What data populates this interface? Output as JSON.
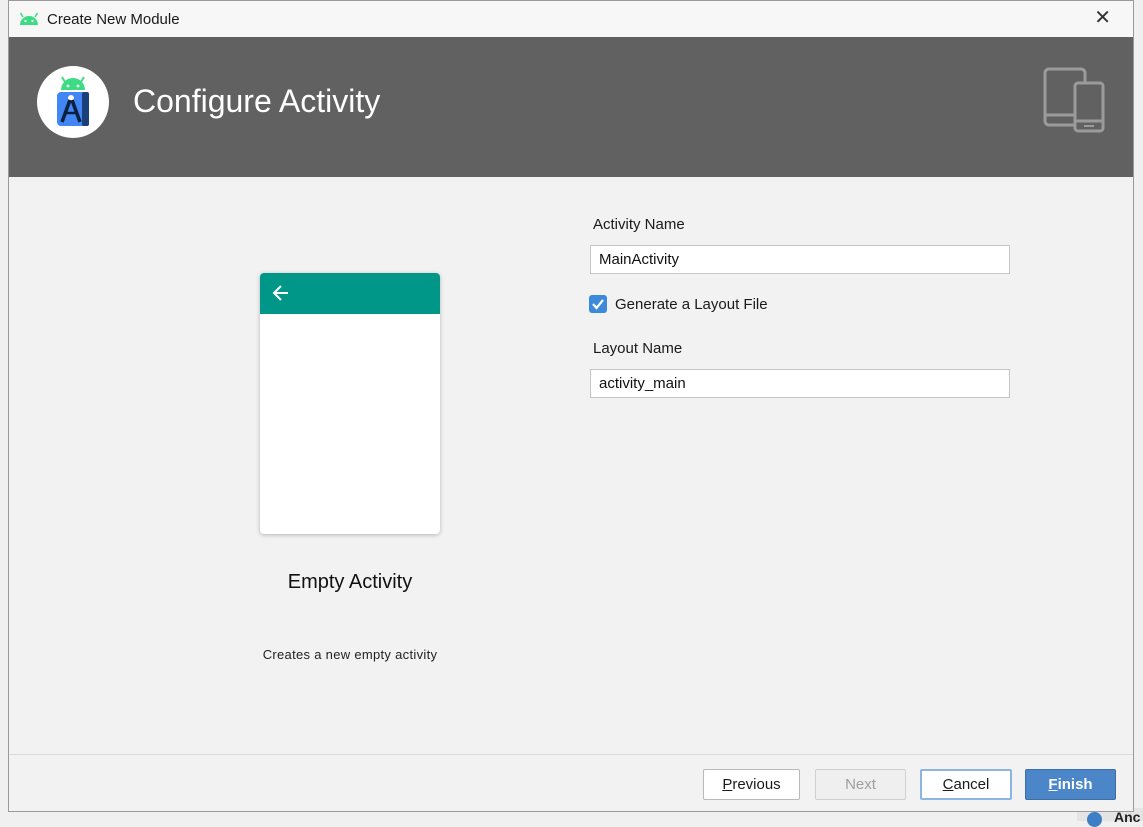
{
  "window": {
    "title": "Create New Module",
    "close_glyph": "✕",
    "app_icon": "android-icon"
  },
  "banner": {
    "heading": "Configure Activity",
    "logo": "android-studio-logo",
    "device_icon": "phone-tablet-icon",
    "background": "#616161"
  },
  "template": {
    "name": "Empty Activity",
    "description": "Creates a new empty activity",
    "appbar_color": "#009688"
  },
  "form": {
    "activity_name_label": "Activity Name",
    "activity_name_value": "MainActivity",
    "generate_layout_label": "Generate a Layout File",
    "generate_layout_checked": true,
    "layout_name_label": "Layout Name",
    "layout_name_value": "activity_main"
  },
  "buttons": {
    "previous": {
      "mnemonic": "P",
      "rest": "revious"
    },
    "next": "Next",
    "cancel": {
      "mnemonic": "C",
      "rest": "ancel"
    },
    "finish": {
      "mnemonic": "F",
      "rest": "inish"
    },
    "accent": "#4a86c8"
  },
  "background_window": {
    "text": "Anc"
  }
}
